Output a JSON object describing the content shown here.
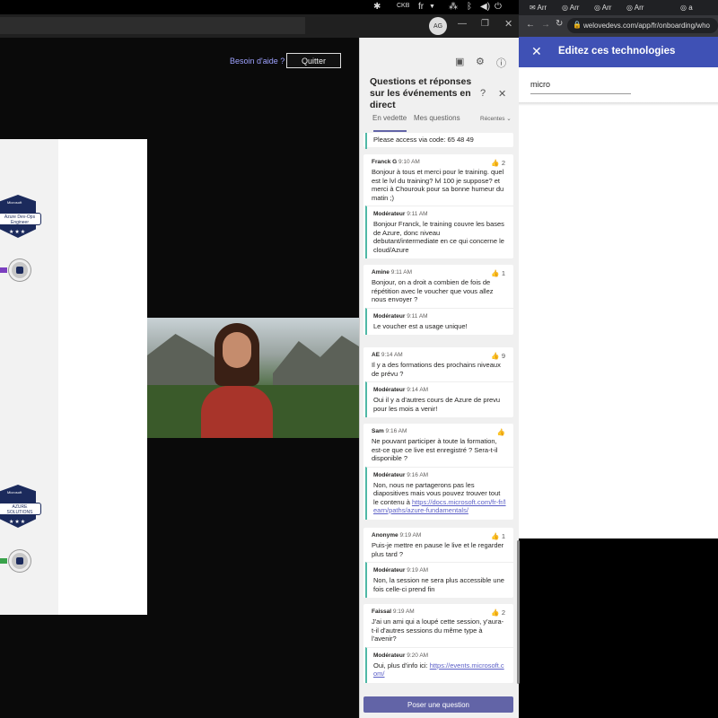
{
  "systray": {
    "lang": "fr",
    "items": [
      "teams-icon",
      "cpu-icon",
      "network-icon",
      "bluetooth-icon",
      "volume-icon",
      "power-icon"
    ]
  },
  "meeting": {
    "help_label": "Besoin d'aide ?",
    "quit_label": "Quitter",
    "avatar_initials": "AG"
  },
  "slide": {
    "badges": [
      {
        "brand": "Microsoft",
        "kind": "CERTIFIED",
        "title": "Azure Dev-Ops Engineer",
        "level": "EXPERT"
      },
      {
        "brand": "Microsoft",
        "kind": "CERTIFIED",
        "title": "AZURE SOLUTIONS ARCHITECT",
        "level": "EXPERT"
      }
    ]
  },
  "qa": {
    "title": "Questions et réponses sur les événements en direct",
    "tabs": [
      "En vedette",
      "Mes questions"
    ],
    "sort_label": "Récentes",
    "ask_button": "Poser une question",
    "top_partial": "Please access via code: 65 48 49",
    "threads": [
      {
        "author": "Franck G",
        "time": "9:10 AM",
        "likes": "2",
        "text": "Bonjour à tous et merci pour le training. quel est le lvl du training? lvl 100 je suppose? et merci à Chourouk pour sa bonne humeur du matin ;)",
        "reply_author": "Modérateur",
        "reply_time": "9:11 AM",
        "reply_text": "Bonjour Franck, le training couvre les bases de Azure, donc niveau debutant/intermediate en ce qui concerne le cloud/Azure",
        "reply_link": ""
      },
      {
        "author": "Amine",
        "time": "9:11 AM",
        "likes": "1",
        "text": "Bonjour, on a droit a combien de fois de répétition avec le voucher que vous allez nous envoyer ?",
        "reply_author": "Modérateur",
        "reply_time": "9:11 AM",
        "reply_text": "Le voucher est a usage unique!",
        "reply_link": ""
      },
      {
        "author": "AE",
        "time": "9:14 AM",
        "likes": "9",
        "text": "Il y a des formations des prochains niveaux de prévu ?",
        "reply_author": "Modérateur",
        "reply_time": "9:14 AM",
        "reply_text": "Oui il y a d'autres cours de Azure de prevu pour les mois a venir!",
        "reply_link": ""
      },
      {
        "author": "Sam",
        "time": "9:16 AM",
        "likes": "",
        "text": "Ne pouvant participer à toute la formation, est-ce que ce live est enregistré ? Sera-t-il disponible ?",
        "reply_author": "Modérateur",
        "reply_time": "9:16 AM",
        "reply_text": "Non, nous ne partagerons pas les diapositives mais vous pouvez trouver tout le contenu à ",
        "reply_link": "https://docs.microsoft.com/fr-fr/learn/paths/azure-fundamentals/"
      },
      {
        "author": "Anonyme",
        "time": "9:19 AM",
        "likes": "1",
        "text": "Puis-je mettre en pause le live et le regarder plus tard ?",
        "reply_author": "Modérateur",
        "reply_time": "9:19 AM",
        "reply_text": "Non, la session ne sera plus accessible une fois celle-ci prend fin",
        "reply_link": ""
      },
      {
        "author": "Faissal",
        "time": "9:19 AM",
        "likes": "2",
        "text": "J'ai un ami qui a loupé cette session, y'aura-t-il d'autres sessions du même type à l'avenir?",
        "reply_author": "Modérateur",
        "reply_time": "9:20 AM",
        "reply_text": "Oui, plus d'info ici: ",
        "reply_link": "https://events.microsoft.com/"
      }
    ]
  },
  "browser": {
    "tabs": [
      "Arr",
      "Arr",
      "Arr",
      "Arr",
      "a"
    ],
    "url": "welovedevs.com/app/fr/onboarding/who",
    "dialog_title": "Editez ces technologies",
    "field_value": "micro"
  }
}
